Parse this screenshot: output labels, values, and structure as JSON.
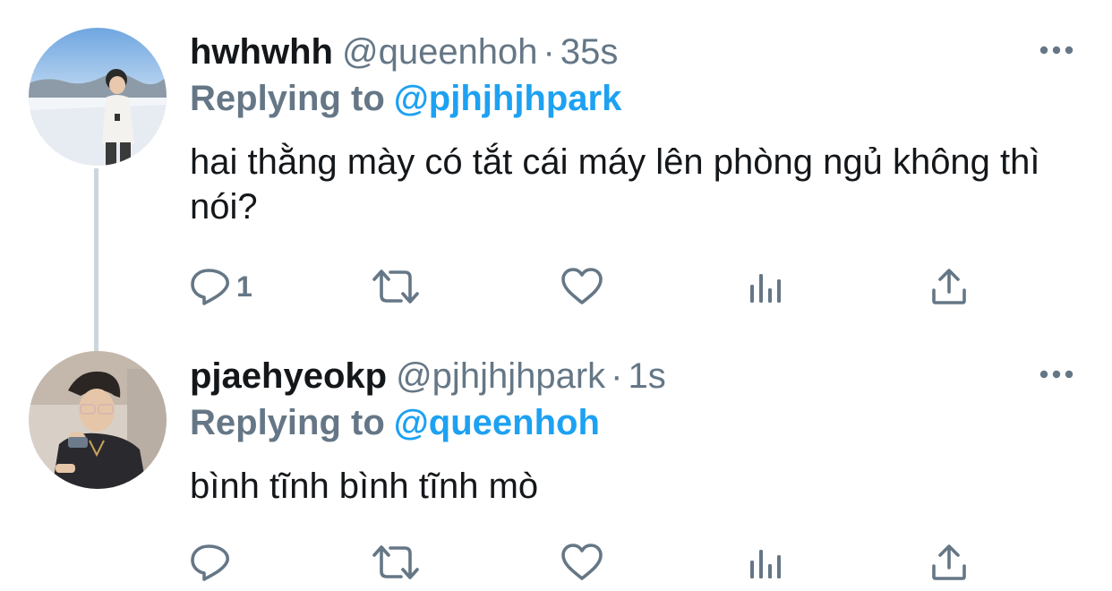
{
  "colors": {
    "text": "#14171a",
    "secondary": "#657786",
    "accent": "#1da1f2",
    "thread_line": "#ccd6dd"
  },
  "tweets": [
    {
      "display_name": "hwhwhh",
      "handle": "@queenhoh",
      "separator": "·",
      "time": "35s",
      "replying_label": "Replying to",
      "replying_target": "@pjhjhjhpark",
      "text": "hai thằng mày có tắt cái máy lên phòng ngủ không thì nói?",
      "reply_count": "1",
      "icons": [
        "reply-icon",
        "retweet-icon",
        "like-icon",
        "analytics-icon",
        "share-icon",
        "more-icon"
      ]
    },
    {
      "display_name": "pjaehyeokp",
      "handle": "@pjhjhjhpark",
      "separator": "·",
      "time": "1s",
      "replying_label": "Replying to",
      "replying_target": "@queenhoh",
      "text": "bình tĩnh bình tĩnh mò",
      "reply_count": "",
      "icons": [
        "reply-icon",
        "retweet-icon",
        "like-icon",
        "analytics-icon",
        "share-icon",
        "more-icon"
      ]
    }
  ]
}
